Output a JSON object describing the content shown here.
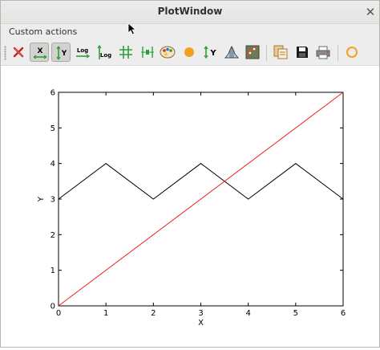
{
  "window": {
    "title": "PlotWindow",
    "close_glyph": "✕"
  },
  "menubar": {
    "custom_actions_label": "Custom actions"
  },
  "toolbar": {
    "buttons": [
      {
        "name": "reset-zoom",
        "icon": "red-x-icon"
      },
      {
        "name": "x-autoscale",
        "icon": "x-autoscale-icon",
        "pressed": true,
        "label": "X"
      },
      {
        "name": "y-autoscale",
        "icon": "y-autoscale-icon",
        "pressed": true,
        "label": "Y"
      },
      {
        "name": "x-log",
        "icon": "x-log-icon",
        "label": "Log"
      },
      {
        "name": "y-log",
        "icon": "y-log-icon",
        "label": "Log"
      },
      {
        "name": "grid",
        "icon": "grid-icon"
      },
      {
        "name": "curve-style",
        "icon": "curve-style-icon"
      },
      {
        "name": "colormap",
        "icon": "palette-icon"
      },
      {
        "name": "keep-aspect",
        "icon": "orange-dot-icon"
      },
      {
        "name": "y-axis-invert",
        "icon": "y-invert-icon",
        "label": "Y"
      },
      {
        "name": "histogram",
        "icon": "histogram-icon"
      },
      {
        "name": "fit",
        "icon": "fit-icon"
      },
      {
        "name": "copy",
        "icon": "copy-icon"
      },
      {
        "name": "save",
        "icon": "save-icon"
      },
      {
        "name": "print",
        "icon": "print-icon"
      },
      {
        "name": "custom-circle",
        "icon": "orange-circle-icon"
      }
    ],
    "colors": {
      "green": "#2c9e3c",
      "orange": "#f5a021",
      "red": "#cc1f1f"
    }
  },
  "chart_data": {
    "type": "line",
    "title": "",
    "xlabel": "X",
    "ylabel": "Y",
    "xlim": [
      0,
      6
    ],
    "ylim": [
      0,
      6
    ],
    "xticks": [
      "0",
      "1",
      "2",
      "3",
      "4",
      "5",
      "6"
    ],
    "yticks": [
      "0",
      "1",
      "2",
      "3",
      "4",
      "5",
      "6"
    ],
    "grid": false,
    "series": [
      {
        "color": "#000000",
        "x": [
          0,
          1,
          2,
          3,
          4,
          5,
          6
        ],
        "y": [
          3,
          4,
          3,
          4,
          3,
          4,
          3
        ]
      },
      {
        "color": "#e8231f",
        "x": [
          0,
          6
        ],
        "y": [
          0,
          6
        ]
      }
    ]
  }
}
